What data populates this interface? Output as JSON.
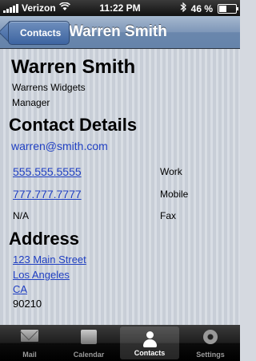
{
  "status_bar": {
    "carrier": "Verizon",
    "time": "11:22 PM",
    "battery": "46 %",
    "battery_level": 0.46
  },
  "nav": {
    "back_label": "Contacts",
    "title": "Warren Smith"
  },
  "contact": {
    "name": "Warren Smith",
    "company": "Warrens Widgets",
    "job_title": "Manager",
    "details_heading": "Contact Details",
    "email": "warren@smith.com",
    "phones": [
      {
        "number": "555.555.5555",
        "label": "Work"
      },
      {
        "number": "777.777.7777",
        "label": "Mobile"
      },
      {
        "number": "N/A",
        "label": "Fax"
      }
    ],
    "address_heading": "Address",
    "address": {
      "street": "123 Main Street",
      "city": "Los Angeles",
      "state": "CA",
      "zip": "90210"
    }
  },
  "tabs": [
    {
      "label": "Mail",
      "icon": "mail-icon"
    },
    {
      "label": "Calendar",
      "icon": "calendar-icon"
    },
    {
      "label": "Contacts",
      "icon": "contacts-icon",
      "selected": true
    },
    {
      "label": "Settings",
      "icon": "settings-icon"
    }
  ]
}
